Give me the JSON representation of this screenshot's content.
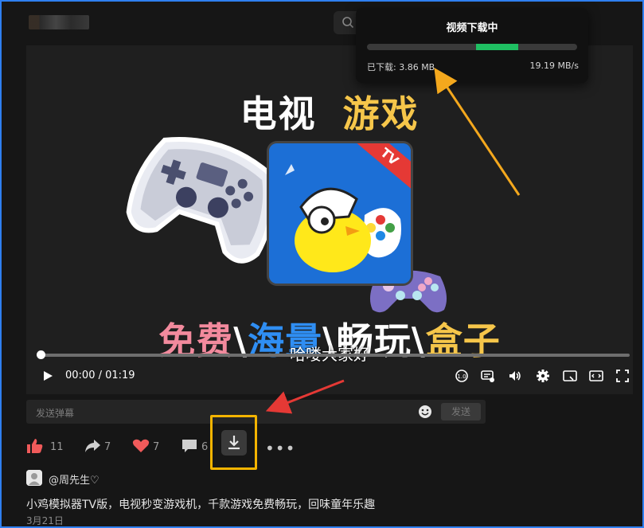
{
  "search": {
    "placeholder": "搜索"
  },
  "video": {
    "title_left": "电视",
    "title_right": "游戏",
    "app_badge": "TV",
    "bottom_parts": [
      "免费",
      "\\",
      "海量",
      "\\",
      "畅玩",
      "\\",
      "盒子"
    ],
    "subtitle": "哈喽大家好",
    "time": "00:00 / 01:19",
    "progress": 0.0
  },
  "download_popup": {
    "title": "视频下载中",
    "downloaded_label": "已下载: 3.86 MB",
    "speed": "19.19 MB/s",
    "progress": 0.2
  },
  "danmaku": {
    "placeholder": "发送弹幕",
    "send_label": "发送"
  },
  "actions": {
    "likes": "11",
    "shares": "7",
    "favorites": "7",
    "comments": "6"
  },
  "author": {
    "name": "@周先生♡"
  },
  "description": "小鸡模拟器TV版，电视秒变游戏机，千款游戏免费畅玩，回味童年乐趣",
  "date": "3月21日",
  "colors": {
    "accent_blue": "#2f7ff0",
    "download_green": "#1fbf62",
    "highlight_yellow": "#f4b400",
    "like_red": "#f05a5a"
  }
}
